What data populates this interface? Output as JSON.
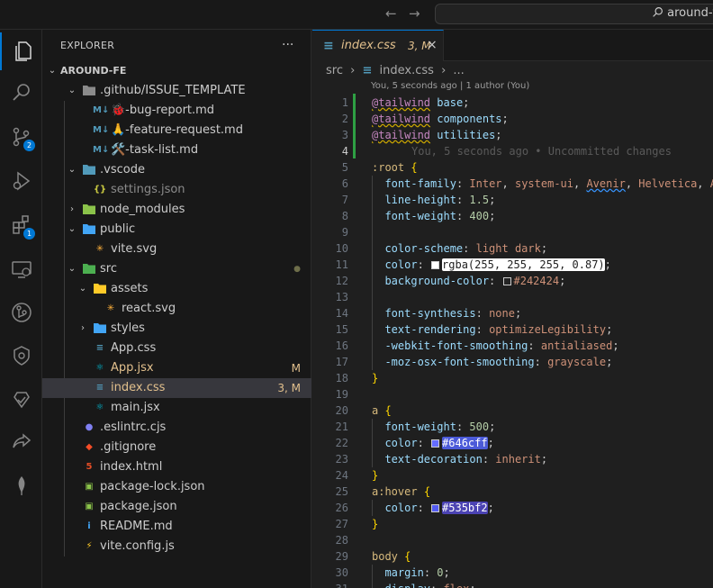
{
  "titlebar": {
    "search_text": "around-f"
  },
  "activity_bar": {
    "items": [
      {
        "icon": "explorer-icon",
        "active": true
      },
      {
        "icon": "search-icon"
      },
      {
        "icon": "source-control-icon",
        "badge": "2"
      },
      {
        "icon": "run-debug-icon"
      },
      {
        "icon": "extensions-icon",
        "badge": "1"
      },
      {
        "icon": "remote-explorer-icon"
      },
      {
        "icon": "gitlens-icon"
      },
      {
        "icon": "git-graph-icon"
      },
      {
        "icon": "testing-icon"
      },
      {
        "icon": "share-icon"
      },
      {
        "icon": "mongodb-leaf-icon"
      }
    ]
  },
  "sidebar": {
    "title": "EXPLORER",
    "more": "...",
    "root": "AROUND-FE",
    "rows": [
      {
        "label": ".github/ISSUE_TEMPLATE",
        "depth": 1,
        "kind": "folder-open",
        "icon_color": "#8b8b8b"
      },
      {
        "label": "🐞-bug-report.md",
        "depth": 2,
        "kind": "md"
      },
      {
        "label": "🙏-feature-request.md",
        "depth": 2,
        "kind": "md"
      },
      {
        "label": "🛠️-task-list.md",
        "depth": 2,
        "kind": "md"
      },
      {
        "label": ".vscode",
        "depth": 1,
        "kind": "folder-open",
        "icon_color": "#519aba"
      },
      {
        "label": "settings.json",
        "depth": 2,
        "kind": "json-braces",
        "dim": true
      },
      {
        "label": "node_modules",
        "depth": 1,
        "kind": "folder-closed",
        "icon_color": "#8bc34a"
      },
      {
        "label": "public",
        "depth": 1,
        "kind": "folder-open",
        "icon_color": "#42a5f5"
      },
      {
        "label": "vite.svg",
        "depth": 2,
        "kind": "svg"
      },
      {
        "label": "src",
        "depth": 1,
        "kind": "folder-open",
        "icon_color": "#4caf50",
        "status": "●"
      },
      {
        "label": "assets",
        "depth": 2,
        "kind": "folder-open",
        "icon_color": "#ffca28"
      },
      {
        "label": "react.svg",
        "depth": 3,
        "kind": "svg"
      },
      {
        "label": "styles",
        "depth": 2,
        "kind": "folder-closed",
        "icon_color": "#42a5f5"
      },
      {
        "label": "App.css",
        "depth": 2,
        "kind": "css"
      },
      {
        "label": "App.jsx",
        "depth": 2,
        "kind": "react",
        "status": "M",
        "modified": true
      },
      {
        "label": "index.css",
        "depth": 2,
        "kind": "css",
        "status": "3, M",
        "modified": true,
        "selected": true
      },
      {
        "label": "main.jsx",
        "depth": 2,
        "kind": "react"
      },
      {
        "label": ".eslintrc.cjs",
        "depth": 1,
        "kind": "eslint"
      },
      {
        "label": ".gitignore",
        "depth": 1,
        "kind": "git"
      },
      {
        "label": "index.html",
        "depth": 1,
        "kind": "html"
      },
      {
        "label": "package-lock.json",
        "depth": 1,
        "kind": "npm"
      },
      {
        "label": "package.json",
        "depth": 1,
        "kind": "npm"
      },
      {
        "label": "README.md",
        "depth": 1,
        "kind": "info"
      },
      {
        "label": "vite.config.js",
        "depth": 1,
        "kind": "vite"
      }
    ]
  },
  "tab": {
    "name": "index.css",
    "status": "3, M",
    "close": "×"
  },
  "breadcrumbs": [
    "src",
    "›",
    "index.css",
    "›",
    "..."
  ],
  "codelens": "You, 5 seconds ago | 1 author (You)",
  "blame": "You, 5 seconds ago • Uncommitted changes",
  "editor": {
    "lines": [
      {
        "n": "1",
        "html": "<span class='at wavy'>@tailwind</span> <span class='pr'>base</span>;"
      },
      {
        "n": "2",
        "html": "<span class='at wavy'>@tailwind</span> <span class='pr'>components</span>;"
      },
      {
        "n": "3",
        "html": "<span class='at wavy'>@tailwind</span> <span class='pr'>utilities</span>;"
      },
      {
        "n": "4",
        "html": ""
      },
      {
        "n": "5",
        "html": "<span class='kw'>:root</span> <span class='br'>{</span>"
      },
      {
        "n": "6",
        "html": "  <span class='pr'>font-family</span>: <span class='va'>Inter</span>, <span class='va'>system-ui</span>, <span class='va wavyb'>Avenir</span>, <span class='va'>Helvetica</span>, <span class='va'>Arial</span>"
      },
      {
        "n": "7",
        "html": "  <span class='pr'>line-height</span>: <span class='nu'>1.5</span>;"
      },
      {
        "n": "8",
        "html": "  <span class='pr'>font-weight</span>: <span class='nu'>400</span>;"
      },
      {
        "n": "9",
        "html": ""
      },
      {
        "n": "10",
        "html": "  <span class='pr'>color-scheme</span>: <span class='va'>light dark</span>;"
      },
      {
        "n": "11",
        "html": "  <span class='pr'>color</span>: <span class='sw' style='background:#ffffff'></span><span class='hl'>rgba(255, 255, 255, 0.87)</span>;"
      },
      {
        "n": "12",
        "html": "  <span class='pr'>background-color</span>: <span class='sw' style='background:#242424'></span><span class='va'>#242424</span>;"
      },
      {
        "n": "13",
        "html": ""
      },
      {
        "n": "14",
        "html": "  <span class='pr'>font-synthesis</span>: <span class='va'>none</span>;"
      },
      {
        "n": "15",
        "html": "  <span class='pr'>text-rendering</span>: <span class='va'>optimizeLegibility</span>;"
      },
      {
        "n": "16",
        "html": "  <span class='pr'>-webkit-font-smoothing</span>: <span class='va'>antialiased</span>;"
      },
      {
        "n": "17",
        "html": "  <span class='pr'>-moz-osx-font-smoothing</span>: <span class='va'>grayscale</span>;"
      },
      {
        "n": "18",
        "html": "<span class='br'>}</span>"
      },
      {
        "n": "19",
        "html": ""
      },
      {
        "n": "20",
        "html": "<span class='kw'>a</span> <span class='br'>{</span>"
      },
      {
        "n": "21",
        "html": "  <span class='pr'>font-weight</span>: <span class='nu'>500</span>;"
      },
      {
        "n": "22",
        "html": "  <span class='pr'>color</span>: <span class='sw' style='background:#646cff'></span><span class='hlb'>#646cff</span>;"
      },
      {
        "n": "23",
        "html": "  <span class='pr'>text-decoration</span>: <span class='va'>inherit</span>;"
      },
      {
        "n": "24",
        "html": "<span class='br'>}</span>"
      },
      {
        "n": "25",
        "html": "<span class='kw'>a:hover</span> <span class='br'>{</span>"
      },
      {
        "n": "26",
        "html": "  <span class='pr'>color</span>: <span class='sw' style='background:#535bf2'></span><span class='hlc'>#535bf2</span>;"
      },
      {
        "n": "27",
        "html": "<span class='br'>}</span>"
      },
      {
        "n": "28",
        "html": ""
      },
      {
        "n": "29",
        "html": "<span class='kw'>body</span> <span class='br'>{</span>"
      },
      {
        "n": "30",
        "html": "  <span class='pr'>margin</span>: <span class='nu'>0</span>;"
      },
      {
        "n": "31",
        "html": "  <span class='pr'>display</span>: <span class='va'>flex</span>;"
      }
    ]
  },
  "colors": {
    "accent": "#0078d4",
    "modified": "#e2c08d",
    "added_gutter": "#2ea043"
  }
}
